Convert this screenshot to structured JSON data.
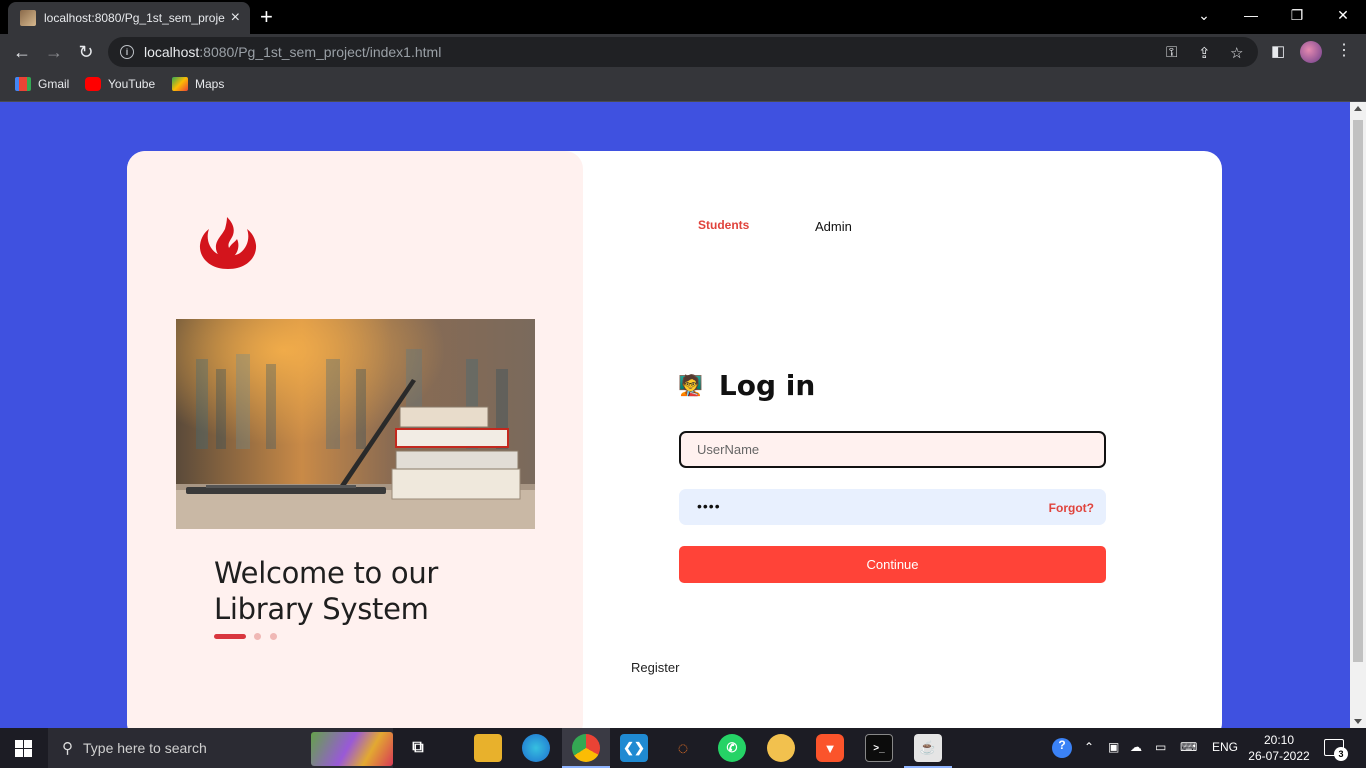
{
  "browser": {
    "tab_title": "localhost:8080/Pg_1st_sem_proje",
    "url_host": "localhost",
    "url_rest": ":8080/Pg_1st_sem_project/index1.html"
  },
  "bookmarks": [
    {
      "label": "Gmail",
      "icon": "gmail-icon"
    },
    {
      "label": "YouTube",
      "icon": "youtube-icon"
    },
    {
      "label": "Maps",
      "icon": "maps-icon"
    }
  ],
  "page": {
    "background_color": "#3f51e0",
    "welcome_line1": "Welcome to our",
    "welcome_line2": "Library System",
    "tabs": {
      "students": "Students",
      "admin": "Admin",
      "active": "Students"
    },
    "login_emoji": "🧑‍🏫",
    "login_title": "Log in",
    "username_placeholder": "UserName",
    "password_masked": "••••",
    "forgot_label": "Forgot?",
    "continue_label": "Continue",
    "register_label": "Register",
    "accent_color": "#ff4338",
    "carousel": {
      "slides": 3,
      "active": 1
    }
  },
  "taskbar": {
    "search_placeholder": "Type here to search",
    "language": "ENG",
    "time": "20:10",
    "date": "26-07-2022",
    "notification_count": "3"
  }
}
